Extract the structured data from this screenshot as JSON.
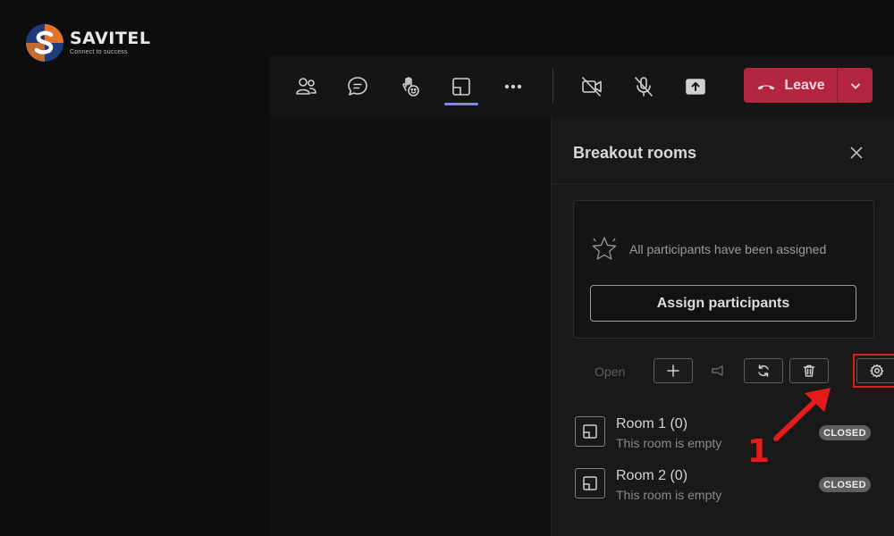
{
  "logo": {
    "name": "SAVITEL",
    "tagline": "Connect to success"
  },
  "toolbar": {
    "buttons": [
      {
        "icon": "people-icon"
      },
      {
        "icon": "chat-icon"
      },
      {
        "icon": "reactions-icon"
      },
      {
        "icon": "rooms-icon",
        "active": true
      },
      {
        "icon": "more-icon"
      },
      {
        "icon": "camera-off-icon"
      },
      {
        "icon": "mic-off-icon"
      },
      {
        "icon": "share-icon"
      }
    ],
    "leave_label": "Leave",
    "leave_color": "#b3253f",
    "active_color": "#7f85f5"
  },
  "panel": {
    "title": "Breakout rooms",
    "assign_status": "All participants have been assigned",
    "assign_button": "Assign participants",
    "actions": {
      "open_label": "Open"
    },
    "rooms": [
      {
        "name": "Room 1 ",
        "count": "(0)",
        "status": "This room is empty",
        "badge": "CLOSED"
      },
      {
        "name": "Room 2 ",
        "count": "(0)",
        "status": "This room is empty",
        "badge": "CLOSED"
      }
    ]
  },
  "annotation": {
    "label": "1",
    "color": "#e51b1b"
  }
}
